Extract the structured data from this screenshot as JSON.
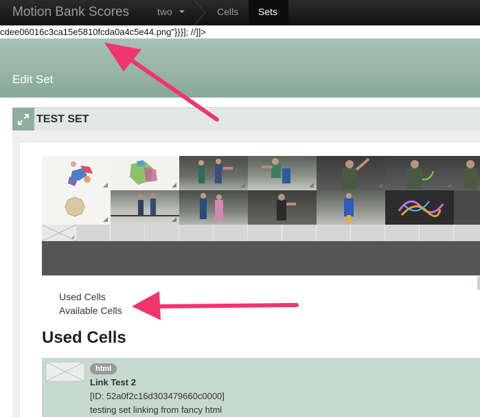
{
  "navbar": {
    "brand": "Motion Bank Scores",
    "dropdown_label": "two",
    "items": [
      {
        "label": "Cells",
        "active": false
      },
      {
        "label": "Sets",
        "active": true
      }
    ]
  },
  "leaked_code": "cdee06016c3ca15e5810fcda0a4c5e44.png\"}}}]; //]]>",
  "page_title": "Edit Set",
  "set_panel": {
    "title": "TEST SET",
    "expand_icon": "expand-arrows-icon"
  },
  "thumbnail_rows": [
    [
      {
        "kind": "sketch-shapes"
      },
      {
        "kind": "sketch-shapes"
      },
      {
        "kind": "video-still"
      },
      {
        "kind": "video-still"
      },
      {
        "kind": "video-still"
      },
      {
        "kind": "video-still"
      },
      {
        "kind": "video-still"
      }
    ],
    [
      {
        "kind": "sketch-shapes"
      },
      {
        "kind": "video-still"
      },
      {
        "kind": "video-still"
      },
      {
        "kind": "video-still"
      },
      {
        "kind": "video-still"
      },
      {
        "kind": "video-still"
      },
      {
        "kind": "video-still"
      }
    ]
  ],
  "links": {
    "used_cells": "Used Cells",
    "available_cells": "Available Cells"
  },
  "section_heading": "Used Cells",
  "used_cells": [
    {
      "badge": "html",
      "title": "Link Test 2",
      "id_text": "[ID: 52a0f2c16d303479660c0000]",
      "description": "testing set linking from fancy html"
    }
  ],
  "colors": {
    "annotation_arrow": "#f0356d",
    "header_green": "#98b5a8",
    "card_green": "#c5d9cf"
  }
}
